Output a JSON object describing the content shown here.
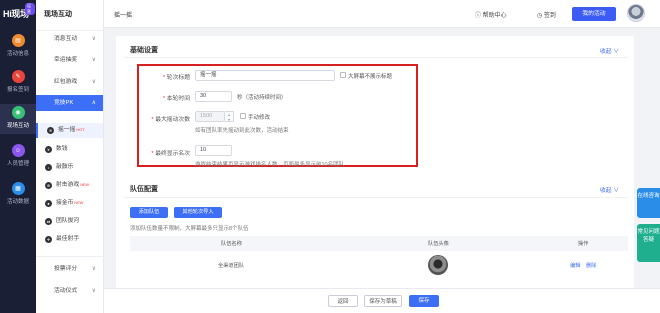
{
  "brand": {
    "logo_text": "Hi现场",
    "logo_badge": "运营"
  },
  "rail": [
    {
      "label": "活动信息",
      "icon": "doc-icon",
      "color": "#f08a2c"
    },
    {
      "label": "报名签到",
      "icon": "signup-icon",
      "color": "#e8463c"
    },
    {
      "label": "现场互动",
      "icon": "interact-icon",
      "color": "#35c274"
    },
    {
      "label": "人员管理",
      "icon": "people-icon",
      "color": "#8a56ee"
    },
    {
      "label": "活动数据",
      "icon": "data-icon",
      "color": "#2a8ee8"
    }
  ],
  "menu": {
    "title": "现场互动",
    "groups": [
      {
        "label": "消息互动",
        "chev": "∨"
      },
      {
        "label": "幸运抽奖",
        "chev": "∨"
      },
      {
        "label": "红包游戏",
        "chev": "∨"
      },
      {
        "label": "竞技PK",
        "chev": "∧"
      }
    ],
    "subitems": [
      {
        "label": "摇一摇",
        "hot": "HOT"
      },
      {
        "label": "数钱",
        "hot": ""
      },
      {
        "label": "敲鼓乐",
        "hot": ""
      },
      {
        "label": "射击游戏",
        "hot": "NEW"
      },
      {
        "label": "接金币",
        "hot": "NEW"
      },
      {
        "label": "团队拔河",
        "hot": ""
      },
      {
        "label": "最佳射手",
        "hot": ""
      }
    ],
    "groups_after": [
      {
        "label": "投票评分",
        "chev": "∨"
      },
      {
        "label": "活动仪式",
        "chev": "∨"
      }
    ]
  },
  "topbar": {
    "page_title": "摇一摇",
    "help": "帮助中心",
    "sign": "签到",
    "my_event": "我的活动"
  },
  "basic": {
    "title": "基础设置",
    "fold": "收起 ∨",
    "round_title_label": "轮次标题",
    "round_title_value": "摇一摇",
    "hide_title_label": "大屏幕不展示标题",
    "round_time_label": "本轮时间",
    "round_time_value": "30",
    "round_time_unit": "秒（活动持续时间）",
    "max_shake_label": "最大摇动次数",
    "max_shake_value": "1500",
    "manual_edit_label": "手动修改",
    "max_shake_note": "如有团队率先摇动到此次数，活动结束",
    "top_show_label": "最终显示名次",
    "top_show_value": "10",
    "top_show_note": "游戏结束结果页显示游戏排名人数，页面最多显示前10名团队"
  },
  "team": {
    "title": "队伍配置",
    "fold": "收起 ∨",
    "add_button": "添加队伍",
    "import_button": "其他轮次导入",
    "hint": "添加队伍数量不限制，大屏幕最多只显示8个队伍",
    "columns": [
      "队伍名称",
      "队伍头像",
      "操作"
    ],
    "rows": [
      {
        "name": "全渠道团队",
        "edit": "编辑",
        "delete": "删除"
      }
    ]
  },
  "footer": {
    "back": "返回",
    "save_preview": "保存为草稿",
    "save": "保存"
  },
  "float": {
    "online": "在线咨询",
    "faq": "常见问题答疑"
  }
}
